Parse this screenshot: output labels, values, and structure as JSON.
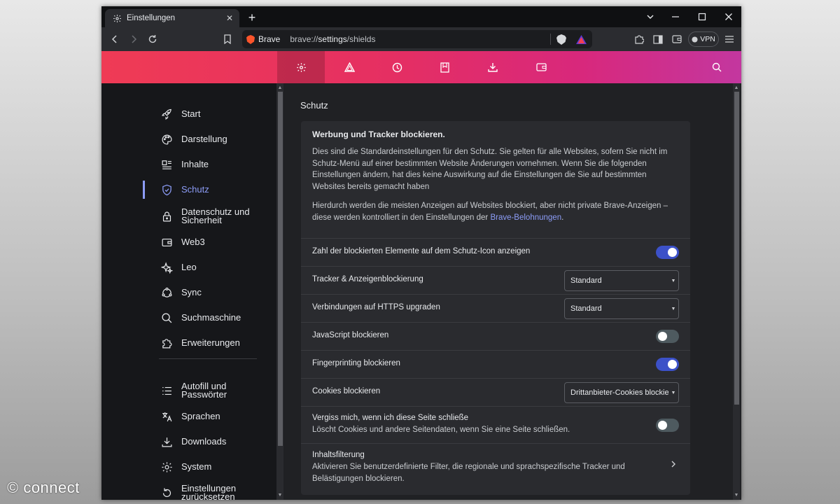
{
  "tab": {
    "title": "Einstellungen",
    "close": "✕"
  },
  "new_tab": "+",
  "url": {
    "brand": "Brave",
    "prefix": "brave://",
    "host": "settings",
    "path": "/shields"
  },
  "vpn_label": "VPN",
  "sidebar": {
    "items": [
      {
        "label": "Start",
        "icon": "rocket-icon"
      },
      {
        "label": "Darstellung",
        "icon": "palette-icon"
      },
      {
        "label": "Inhalte",
        "icon": "content-icon"
      },
      {
        "label": "Schutz",
        "icon": "shield-icon",
        "active": true
      },
      {
        "label": "Datenschutz und Sicherheit",
        "icon": "lock-icon"
      },
      {
        "label": "Web3",
        "icon": "wallet-icon"
      },
      {
        "label": "Leo",
        "icon": "sparkle-icon"
      },
      {
        "label": "Sync",
        "icon": "sync-icon"
      },
      {
        "label": "Suchmaschine",
        "icon": "search-icon"
      },
      {
        "label": "Erweiterungen",
        "icon": "puzzle-icon"
      },
      {
        "label": "Autofill und Passwörter",
        "icon": "autofill-icon"
      },
      {
        "label": "Sprachen",
        "icon": "translate-icon"
      },
      {
        "label": "Downloads",
        "icon": "download-icon"
      },
      {
        "label": "System",
        "icon": "gear-icon"
      },
      {
        "label": "Einstellungen zurücksetzen",
        "icon": "reset-icon"
      }
    ]
  },
  "main": {
    "section_title": "Schutz",
    "intro_title": "Werbung und Tracker blockieren.",
    "intro_p1": "Dies sind die Standardeinstellungen für den Schutz. Sie gelten für alle Websites, sofern Sie nicht im Schutz-Menü auf einer bestimmten Website Änderungen vornehmen. Wenn Sie die folgenden Einstellungen ändern, hat dies keine Auswirkung auf die Einstellungen die Sie auf bestimmten Websites bereits gemacht haben",
    "intro_p2_text": "Hierdurch werden die meisten Anzeigen auf Websites blockiert, aber nicht private Brave-Anzeigen – diese werden kontrolliert in den Einstellungen der ",
    "intro_p2_link": "Brave-Belohnungen",
    "intro_p2_end": ".",
    "rows": [
      {
        "label": "Zahl der blockierten Elemente auf dem Schutz-Icon anzeigen",
        "toggle": true
      },
      {
        "label": "Tracker & Anzeigenblockierung",
        "select": "Standard"
      },
      {
        "label": "Verbindungen auf HTTPS upgraden",
        "select": "Standard"
      },
      {
        "label": "JavaScript blockieren",
        "toggle": false
      },
      {
        "label": "Fingerprinting blockieren",
        "toggle": true
      },
      {
        "label": "Cookies blockieren",
        "select": "Drittanbieter-Cookies blockieren"
      },
      {
        "label": "Vergiss mich, wenn ich diese Seite schließe",
        "sub": "Löscht Cookies und andere Seitendaten, wenn Sie eine Seite schließen.",
        "toggle": false
      },
      {
        "label": "Inhaltsfilterung",
        "sub": "Aktivieren Sie benutzerdefinierte Filter, die regionale und sprachspezifische Tracker und Belästigungen blockieren."
      }
    ]
  },
  "watermark": "© connect",
  "colors": {
    "accent": "#8c9cf6",
    "toggle_on": "#3c51c8",
    "header_start": "#ef3b55",
    "header_end": "#c3379f"
  }
}
